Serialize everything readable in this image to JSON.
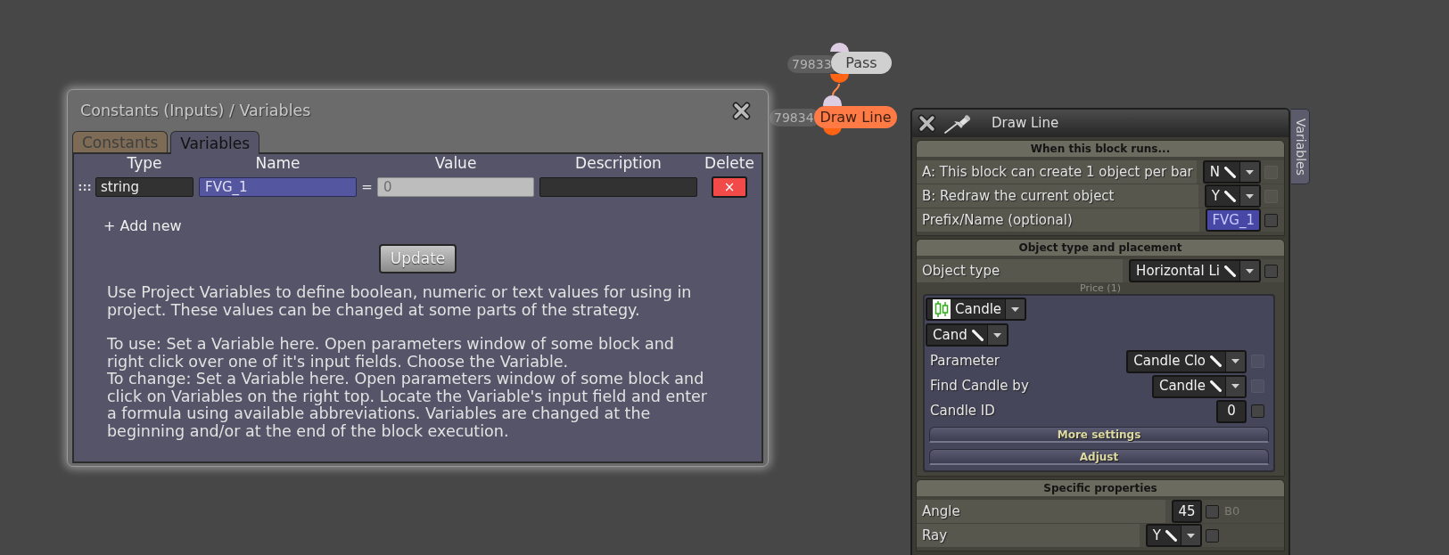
{
  "canvas_nodes": [
    {
      "id": "79833",
      "label": "Pass",
      "kind": "pass"
    },
    {
      "id": "79834",
      "label": "Draw Line",
      "kind": "action"
    }
  ],
  "variables_dialog": {
    "title": "Constants (Inputs) / Variables",
    "tabs": [
      {
        "label": "Constants",
        "selected": false
      },
      {
        "label": "Variables",
        "selected": true
      }
    ],
    "columns": [
      "Type",
      "Name",
      "Value",
      "Description",
      "Delete"
    ],
    "rows": [
      {
        "handle": ":::",
        "type": "string",
        "name": "FVG_1",
        "equals": "=",
        "placeholder": "0",
        "delete": "×"
      }
    ],
    "add_new": "+ Add new",
    "update_button": "Update",
    "help_blocks": [
      [
        "Use Project Variables to define boolean, numeric or text values for using in project. These values can be changed at some parts of the strategy."
      ],
      [
        "To use: Set a Variable here. Open parameters window of some block and right click over one of it's input fields. Choose the Variable.",
        "To change: Set a Variable here. Open parameters window of some block and click on Variables on the right top. Locate the Variable's input field and enter a formula using available abbreviations. Variables are changed at the beginning and/or at the end of the block execution."
      ]
    ]
  },
  "block_panel": {
    "title": "Draw Line",
    "side_tab": "Variables",
    "sections": [
      {
        "header": "When this block runs...",
        "rows": [
          {
            "kind": "select",
            "label": "A: This block can create 1 object per bar",
            "value": "N",
            "checkbox": {
              "checked": false,
              "disabled": true
            }
          },
          {
            "kind": "select",
            "label": "B: Redraw the current object",
            "value": "Y",
            "checkbox": {
              "checked": false,
              "disabled": true
            }
          },
          {
            "kind": "variable",
            "label": "Prefix/Name (optional)",
            "value": "FVG_1",
            "checkbox": {
              "checked": false,
              "disabled": false
            }
          }
        ]
      },
      {
        "header": "Object type and placement",
        "rows": [
          {
            "kind": "select",
            "label": "Object type",
            "value": "Horizontal Li",
            "checkbox": {
              "checked": false,
              "disabled": false
            }
          }
        ],
        "group": {
          "caption": "Price (1)",
          "source": "Candle",
          "source_mode": "Cand",
          "rows": [
            {
              "kind": "select",
              "label": "Parameter",
              "value": "Candle Clo",
              "checkbox": {
                "checked": false,
                "disabled": true
              }
            },
            {
              "kind": "select",
              "label": "Find Candle by",
              "value": "Candle",
              "checkbox": {
                "checked": false,
                "disabled": true
              }
            },
            {
              "kind": "number",
              "label": "Candle ID",
              "value": "0",
              "checkbox": {
                "checked": false,
                "disabled": false
              }
            }
          ],
          "buttons": [
            "More settings",
            "Adjust"
          ]
        }
      },
      {
        "header": "Specific properties",
        "rows": [
          {
            "kind": "number",
            "label": "Angle",
            "value": "45",
            "checkbox": {
              "checked": false,
              "disabled": false
            },
            "note": "B0"
          },
          {
            "kind": "select",
            "label": "Ray",
            "value": "Y",
            "checkbox": {
              "checked": false,
              "disabled": false
            }
          }
        ]
      }
    ]
  }
}
